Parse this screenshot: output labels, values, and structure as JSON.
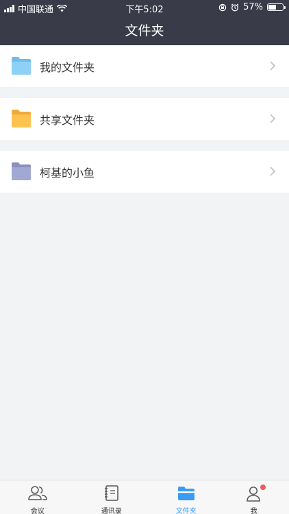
{
  "status_bar": {
    "carrier": "中国联通",
    "time": "下午5:02",
    "battery": "57%",
    "battery_level": 0.57
  },
  "header": {
    "title": "文件夹"
  },
  "folders": [
    {
      "label": "我的文件夹",
      "icon": "folder-blue-icon",
      "color": "#8fd0f7"
    },
    {
      "label": "共享文件夹",
      "icon": "folder-yellow-icon",
      "color": "#fdc34e"
    },
    {
      "label": "柯基的小鱼",
      "icon": "folder-purple-icon",
      "color": "#a0a8d4"
    }
  ],
  "tabs": [
    {
      "label": "会议",
      "icon": "people-icon"
    },
    {
      "label": "通讯录",
      "icon": "contacts-book-icon"
    },
    {
      "label": "文件夹",
      "icon": "folder-icon",
      "active": true
    },
    {
      "label": "我",
      "icon": "person-icon",
      "badge": true
    }
  ],
  "colors": {
    "header_bg": "#393b48",
    "accent": "#3a9cf0",
    "badge": "#f05a5a",
    "page_bg": "#f2f3f5"
  }
}
